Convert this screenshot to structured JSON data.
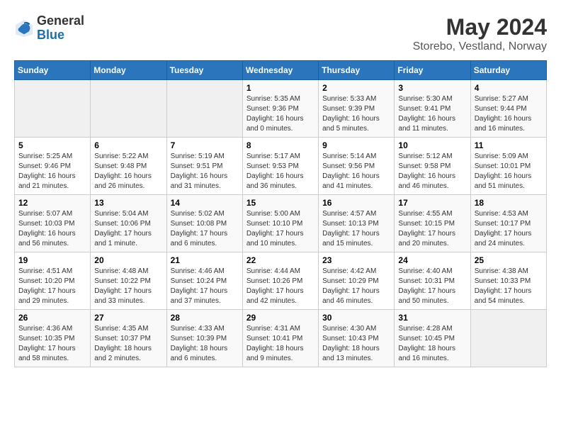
{
  "logo": {
    "general": "General",
    "blue": "Blue"
  },
  "title": "May 2024",
  "subtitle": "Storebo, Vestland, Norway",
  "days_of_week": [
    "Sunday",
    "Monday",
    "Tuesday",
    "Wednesday",
    "Thursday",
    "Friday",
    "Saturday"
  ],
  "weeks": [
    [
      {
        "day": "",
        "info": ""
      },
      {
        "day": "",
        "info": ""
      },
      {
        "day": "",
        "info": ""
      },
      {
        "day": "1",
        "info": "Sunrise: 5:35 AM\nSunset: 9:36 PM\nDaylight: 16 hours\nand 0 minutes."
      },
      {
        "day": "2",
        "info": "Sunrise: 5:33 AM\nSunset: 9:39 PM\nDaylight: 16 hours\nand 5 minutes."
      },
      {
        "day": "3",
        "info": "Sunrise: 5:30 AM\nSunset: 9:41 PM\nDaylight: 16 hours\nand 11 minutes."
      },
      {
        "day": "4",
        "info": "Sunrise: 5:27 AM\nSunset: 9:44 PM\nDaylight: 16 hours\nand 16 minutes."
      }
    ],
    [
      {
        "day": "5",
        "info": "Sunrise: 5:25 AM\nSunset: 9:46 PM\nDaylight: 16 hours\nand 21 minutes."
      },
      {
        "day": "6",
        "info": "Sunrise: 5:22 AM\nSunset: 9:48 PM\nDaylight: 16 hours\nand 26 minutes."
      },
      {
        "day": "7",
        "info": "Sunrise: 5:19 AM\nSunset: 9:51 PM\nDaylight: 16 hours\nand 31 minutes."
      },
      {
        "day": "8",
        "info": "Sunrise: 5:17 AM\nSunset: 9:53 PM\nDaylight: 16 hours\nand 36 minutes."
      },
      {
        "day": "9",
        "info": "Sunrise: 5:14 AM\nSunset: 9:56 PM\nDaylight: 16 hours\nand 41 minutes."
      },
      {
        "day": "10",
        "info": "Sunrise: 5:12 AM\nSunset: 9:58 PM\nDaylight: 16 hours\nand 46 minutes."
      },
      {
        "day": "11",
        "info": "Sunrise: 5:09 AM\nSunset: 10:01 PM\nDaylight: 16 hours\nand 51 minutes."
      }
    ],
    [
      {
        "day": "12",
        "info": "Sunrise: 5:07 AM\nSunset: 10:03 PM\nDaylight: 16 hours\nand 56 minutes."
      },
      {
        "day": "13",
        "info": "Sunrise: 5:04 AM\nSunset: 10:06 PM\nDaylight: 17 hours\nand 1 minute."
      },
      {
        "day": "14",
        "info": "Sunrise: 5:02 AM\nSunset: 10:08 PM\nDaylight: 17 hours\nand 6 minutes."
      },
      {
        "day": "15",
        "info": "Sunrise: 5:00 AM\nSunset: 10:10 PM\nDaylight: 17 hours\nand 10 minutes."
      },
      {
        "day": "16",
        "info": "Sunrise: 4:57 AM\nSunset: 10:13 PM\nDaylight: 17 hours\nand 15 minutes."
      },
      {
        "day": "17",
        "info": "Sunrise: 4:55 AM\nSunset: 10:15 PM\nDaylight: 17 hours\nand 20 minutes."
      },
      {
        "day": "18",
        "info": "Sunrise: 4:53 AM\nSunset: 10:17 PM\nDaylight: 17 hours\nand 24 minutes."
      }
    ],
    [
      {
        "day": "19",
        "info": "Sunrise: 4:51 AM\nSunset: 10:20 PM\nDaylight: 17 hours\nand 29 minutes."
      },
      {
        "day": "20",
        "info": "Sunrise: 4:48 AM\nSunset: 10:22 PM\nDaylight: 17 hours\nand 33 minutes."
      },
      {
        "day": "21",
        "info": "Sunrise: 4:46 AM\nSunset: 10:24 PM\nDaylight: 17 hours\nand 37 minutes."
      },
      {
        "day": "22",
        "info": "Sunrise: 4:44 AM\nSunset: 10:26 PM\nDaylight: 17 hours\nand 42 minutes."
      },
      {
        "day": "23",
        "info": "Sunrise: 4:42 AM\nSunset: 10:29 PM\nDaylight: 17 hours\nand 46 minutes."
      },
      {
        "day": "24",
        "info": "Sunrise: 4:40 AM\nSunset: 10:31 PM\nDaylight: 17 hours\nand 50 minutes."
      },
      {
        "day": "25",
        "info": "Sunrise: 4:38 AM\nSunset: 10:33 PM\nDaylight: 17 hours\nand 54 minutes."
      }
    ],
    [
      {
        "day": "26",
        "info": "Sunrise: 4:36 AM\nSunset: 10:35 PM\nDaylight: 17 hours\nand 58 minutes."
      },
      {
        "day": "27",
        "info": "Sunrise: 4:35 AM\nSunset: 10:37 PM\nDaylight: 18 hours\nand 2 minutes."
      },
      {
        "day": "28",
        "info": "Sunrise: 4:33 AM\nSunset: 10:39 PM\nDaylight: 18 hours\nand 6 minutes."
      },
      {
        "day": "29",
        "info": "Sunrise: 4:31 AM\nSunset: 10:41 PM\nDaylight: 18 hours\nand 9 minutes."
      },
      {
        "day": "30",
        "info": "Sunrise: 4:30 AM\nSunset: 10:43 PM\nDaylight: 18 hours\nand 13 minutes."
      },
      {
        "day": "31",
        "info": "Sunrise: 4:28 AM\nSunset: 10:45 PM\nDaylight: 18 hours\nand 16 minutes."
      },
      {
        "day": "",
        "info": ""
      }
    ]
  ]
}
